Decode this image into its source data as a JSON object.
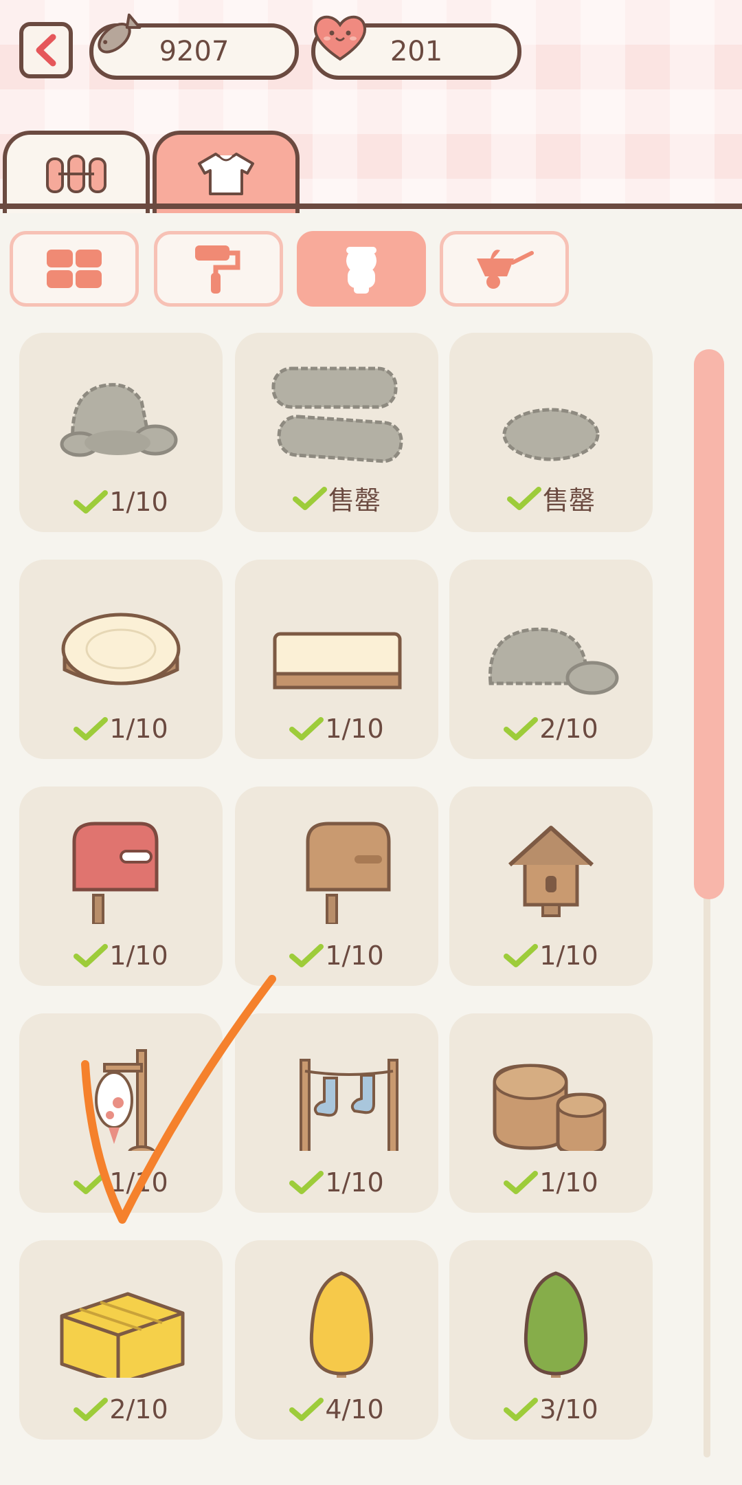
{
  "header": {
    "currency_fish": "9207",
    "currency_heart": "201",
    "back_icon": "chevron-left-icon",
    "fish_icon": "fish-icon",
    "heart_icon": "heart-icon"
  },
  "tabs": [
    {
      "icon": "fence-icon",
      "active": false
    },
    {
      "icon": "shirt-icon",
      "active": true
    }
  ],
  "categories": [
    {
      "icon": "grid-icon",
      "active": false
    },
    {
      "icon": "paint-roller-icon",
      "active": false
    },
    {
      "icon": "figure-icon",
      "active": true
    },
    {
      "icon": "wheelbarrow-icon",
      "active": false
    }
  ],
  "items": [
    {
      "name": "rock-pile",
      "count": "1/10"
    },
    {
      "name": "stone-slabs",
      "count": "售罄"
    },
    {
      "name": "flat-stone",
      "count": "售罄"
    },
    {
      "name": "tree-stump",
      "count": "1/10"
    },
    {
      "name": "wood-plank",
      "count": "1/10"
    },
    {
      "name": "boulder",
      "count": "2/10"
    },
    {
      "name": "red-mailbox",
      "count": "1/10"
    },
    {
      "name": "wooden-mailbox",
      "count": "1/10"
    },
    {
      "name": "birdhouse",
      "count": "1/10"
    },
    {
      "name": "lantern-post",
      "count": "1/10"
    },
    {
      "name": "sock-clothesline",
      "count": "1/10"
    },
    {
      "name": "wooden-barrels",
      "count": "1/10"
    },
    {
      "name": "hay-bale",
      "count": "2/10"
    },
    {
      "name": "yellow-tree",
      "count": "4/10"
    },
    {
      "name": "green-tree",
      "count": "3/10"
    }
  ],
  "colors": {
    "accent": "#f8aa9a",
    "outline": "#6b4a40",
    "check": "#9dcc3a",
    "annotation": "#f5812c"
  },
  "scrollbar": {
    "position_fraction": 0.0
  }
}
